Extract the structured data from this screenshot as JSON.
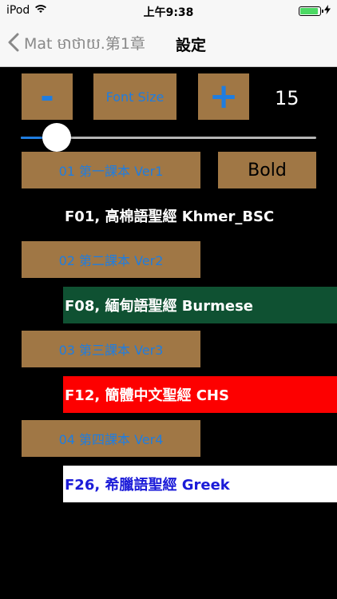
{
  "status_bar": {
    "carrier": "iPod",
    "time": "上午9:38"
  },
  "nav": {
    "back_label": "Mat មាថាយ.第1章",
    "title": "設定"
  },
  "font_controls": {
    "minus_label": "-",
    "font_size_label": "Font Size",
    "plus_label": "+",
    "size_value": "15"
  },
  "slider": {
    "value_fraction": 0.08
  },
  "versions": [
    {
      "label": "01 第一課本 Ver1",
      "text": "F01, 高棉語聖經 Khmer_BSC",
      "row_bg": "#000000",
      "row_color": "#ffffff"
    },
    {
      "label": "02 第二課本 Ver2",
      "text": "F08, 緬甸語聖經 Burmese",
      "row_bg": "#0f5132",
      "row_color": "#ffffff"
    },
    {
      "label": "03 第三課本 Ver3",
      "text": "F12, 簡體中文聖經 CHS",
      "row_bg": "#fd0000",
      "row_color": "#ffffff"
    },
    {
      "label": "04 第四課本 Ver4",
      "text": "F26, 希臘語聖經 Greek",
      "row_bg": "#ffffff",
      "row_color": "#1b1bd8"
    }
  ],
  "bold_label": "Bold",
  "colors": {
    "button_brown": "#a07745",
    "accent_blue": "#1f7de0",
    "background": "#000000"
  }
}
